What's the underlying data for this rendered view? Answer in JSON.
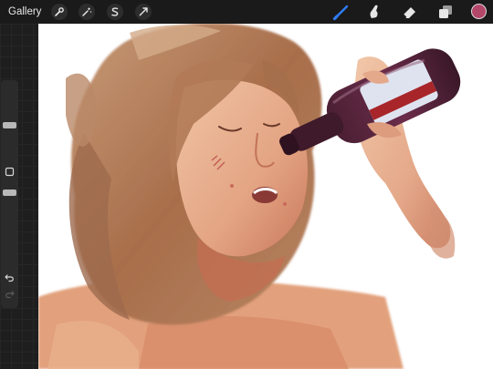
{
  "toolbar": {
    "gallery_label": "Gallery",
    "left_tools": [
      "wrench-icon",
      "magic-wand-icon",
      "selection-s-icon",
      "transform-arrow-icon"
    ],
    "right_tools": [
      "brush-icon",
      "smudge-icon",
      "eraser-icon",
      "layers-icon"
    ],
    "active_tool": "brush-icon",
    "active_tool_color": "#2f7df6",
    "current_color": "#b3476a"
  },
  "sidebar": {
    "brush_size_level": 0.25,
    "opacity_level": 0.5,
    "modify_button_icon": "square-icon",
    "undo_icon": "undo-icon",
    "redo_icon": "redo-icon"
  },
  "canvas": {
    "artwork": "painting-of-person-drinking-from-bottle"
  }
}
